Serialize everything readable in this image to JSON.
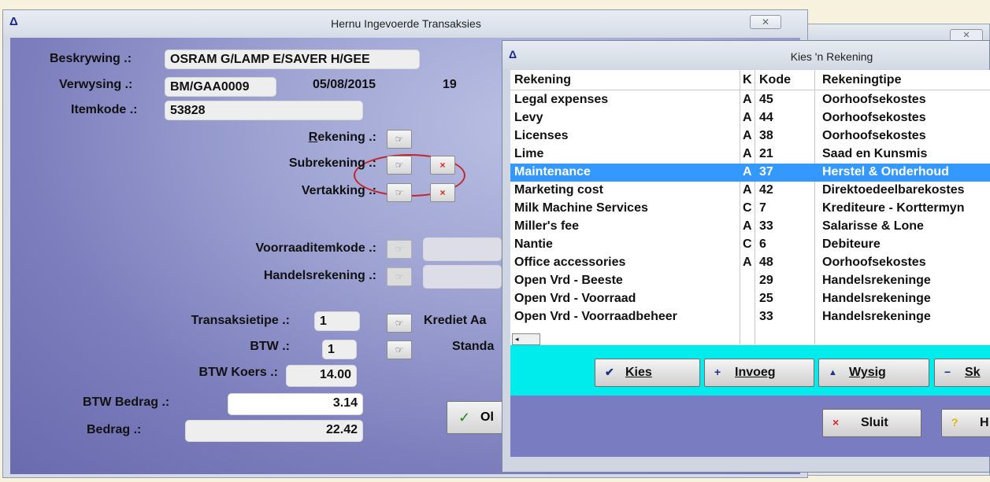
{
  "background_window": {
    "close_glyph": "✕"
  },
  "main": {
    "title": "Hernu Ingevoerde Transaksies",
    "close_glyph": "✕",
    "labels": {
      "beskrywing": "Beskrywing .:",
      "verwysing": "Verwysing .:",
      "itemkode": "Itemkode .:",
      "rekening": "Rekening .:",
      "subrekening": "Subrekening .:",
      "vertakking": "Vertakking .:",
      "voorraaditemkode": "Voorraaditemkode .:",
      "handelsrekening": "Handelsrekening .:",
      "transaksietipe": "Transaksietipe .:",
      "btw": "BTW .:",
      "btw_koers": "BTW Koers .:",
      "btw_bedrag": "BTW Bedrag .:",
      "bedrag": "Bedrag .:",
      "krediet": "Krediet Aa",
      "standaard": "Standa"
    },
    "values": {
      "beskrywing": "OSRAM G/LAMP E/SAVER H/GEE",
      "verwysing": "BM/GAA0009",
      "date": "05/08/2015",
      "period": "19",
      "itemkode": "53828",
      "transaksietipe": "1",
      "btw": "1",
      "btw_koers": "14.00",
      "btw_bedrag": "3.14",
      "bedrag": "22.42"
    },
    "ok_label": "Ol",
    "icons": {
      "pick": "☞",
      "clear": "×",
      "ok": "✓"
    }
  },
  "dialog": {
    "title": "Kies 'n Rekening",
    "columns": [
      "Rekening",
      "K",
      "Kode",
      "Rekeningtipe"
    ],
    "rows": [
      [
        "Legal expenses",
        "A",
        "45",
        "Oorhoofsekostes"
      ],
      [
        "Levy",
        "A",
        "44",
        "Oorhoofsekostes"
      ],
      [
        "Licenses",
        "A",
        "38",
        "Oorhoofsekostes"
      ],
      [
        "Lime",
        "A",
        "21",
        "Saad en Kunsmis"
      ],
      [
        "Maintenance",
        "A",
        "37",
        "Herstel & Onderhoud"
      ],
      [
        "Marketing cost",
        "A",
        "42",
        "Direktoedeelbarekostes"
      ],
      [
        "Milk Machine Services",
        "C",
        "7",
        "Krediteure - Korttermyn"
      ],
      [
        "Miller's fee",
        "A",
        "33",
        "Salarisse & Lone"
      ],
      [
        "Nantie",
        "C",
        "6",
        "Debiteure"
      ],
      [
        "Office accessories",
        "A",
        "48",
        "Oorhoofsekostes"
      ],
      [
        "Open Vrd - Beeste",
        "",
        "29",
        "Handelsrekeninge"
      ],
      [
        "Open Vrd - Voorraad",
        "",
        "25",
        "Handelsrekeninge"
      ],
      [
        "Open Vrd - Voorraadbeheer",
        "",
        "33",
        "Handelsrekeninge"
      ]
    ],
    "selected_row": "Maintenance",
    "scroll_glyph": "◂",
    "buttons": {
      "kies": "Kies",
      "invoeg": "Invoeg",
      "wysig": "Wysig",
      "skrap": "Sk",
      "sluit": "Sluit",
      "help": "H"
    },
    "button_icons": {
      "kies": "✔",
      "invoeg": "+",
      "wysig": "▲",
      "skrap": "−",
      "sluit": "×",
      "help": "?"
    }
  },
  "colors": {
    "selection": "#3399ff",
    "cyan_bar": "#00ecec",
    "panel": "#7b7dbc",
    "annotation": "#c0272d"
  }
}
